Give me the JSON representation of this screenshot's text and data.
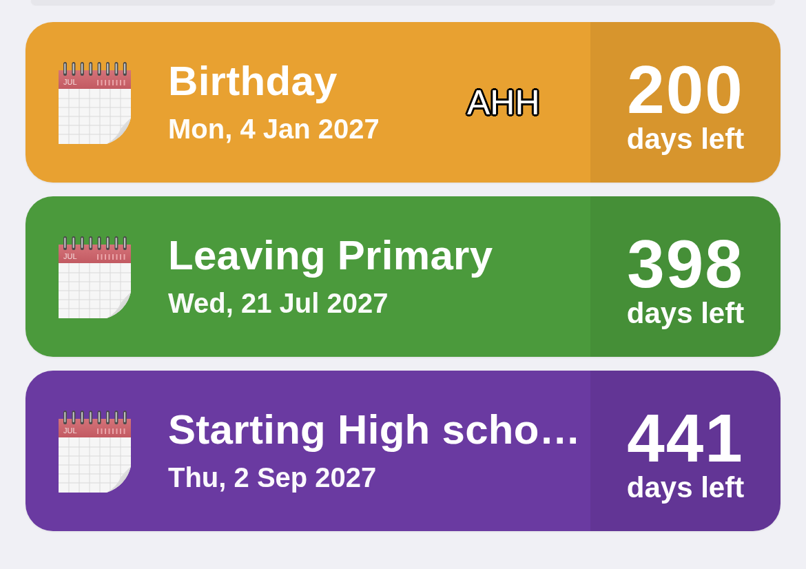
{
  "events": [
    {
      "icon_month": "JUL",
      "title": "Birthday",
      "date": "Mon, 4 Jan 2027",
      "count": "200",
      "count_label": "days left",
      "color": "#e8a131",
      "sticker_text": "AHH"
    },
    {
      "icon_month": "JUL",
      "title": "Leaving Primary",
      "date": "Wed, 21 Jul 2027",
      "count": "398",
      "count_label": "days left",
      "color": "#4b9a3c"
    },
    {
      "icon_month": "JUL",
      "title": "Starting High scho…",
      "date": "Thu, 2 Sep 2027",
      "count": "441",
      "count_label": "days left",
      "color": "#6a3aa1"
    }
  ]
}
